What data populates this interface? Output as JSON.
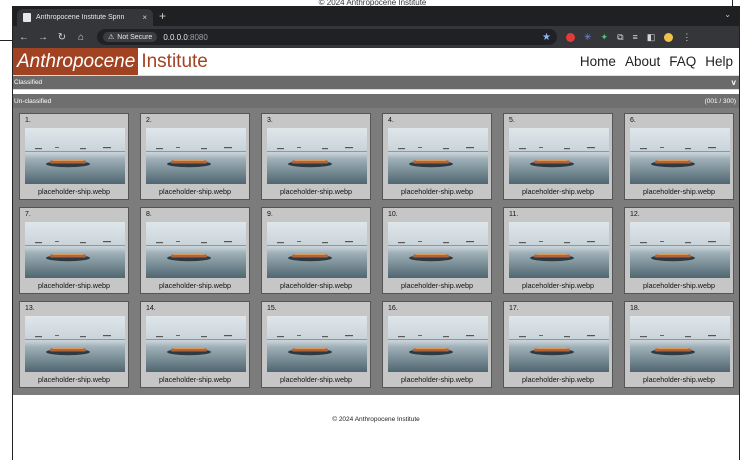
{
  "outer_caption": "© 2024 Anthropocene Institute",
  "browser": {
    "tab_title": "Anthropocene Institute Sprin",
    "tab_close": "×",
    "new_tab": "+",
    "menu_chevron": "⌄",
    "security_label": "Not Secure",
    "url_host": "0.0.0.0",
    "url_port": ":8080",
    "icons": [
      "back-icon",
      "forward-icon",
      "reload-icon",
      "home-icon",
      "bookmark-star-icon",
      "extension-icons",
      "side-panel-icon",
      "profile-icon",
      "kebab-menu-icon"
    ]
  },
  "site": {
    "logo_part1": "Anthropocene",
    "logo_part2": "Institute",
    "brand_color": "#a14322",
    "nav": [
      "Home",
      "About",
      "FAQ",
      "Help"
    ]
  },
  "sections": {
    "classified_label": "Classified",
    "classified_chevron": "v",
    "unclassified_label": "Un-classified",
    "unclassified_count": "(001 / 300)"
  },
  "cards": [
    {
      "num": "1.",
      "file": "placeholder-ship.webp"
    },
    {
      "num": "2.",
      "file": "placeholder-ship.webp"
    },
    {
      "num": "3.",
      "file": "placeholder-ship.webp"
    },
    {
      "num": "4.",
      "file": "placeholder-ship.webp"
    },
    {
      "num": "5.",
      "file": "placeholder-ship.webp"
    },
    {
      "num": "6.",
      "file": "placeholder-ship.webp"
    },
    {
      "num": "7.",
      "file": "placeholder-ship.webp"
    },
    {
      "num": "8.",
      "file": "placeholder-ship.webp"
    },
    {
      "num": "9.",
      "file": "placeholder-ship.webp"
    },
    {
      "num": "10.",
      "file": "placeholder-ship.webp"
    },
    {
      "num": "11.",
      "file": "placeholder-ship.webp"
    },
    {
      "num": "12.",
      "file": "placeholder-ship.webp"
    },
    {
      "num": "13.",
      "file": "placeholder-ship.webp"
    },
    {
      "num": "14.",
      "file": "placeholder-ship.webp"
    },
    {
      "num": "15.",
      "file": "placeholder-ship.webp"
    },
    {
      "num": "16.",
      "file": "placeholder-ship.webp"
    },
    {
      "num": "17.",
      "file": "placeholder-ship.webp"
    },
    {
      "num": "18.",
      "file": "placeholder-ship.webp"
    },
    {
      "num": "",
      "file": ""
    },
    {
      "num": "",
      "file": ""
    },
    {
      "num": "",
      "file": ""
    },
    {
      "num": "",
      "file": ""
    },
    {
      "num": "",
      "file": ""
    },
    {
      "num": "",
      "file": ""
    }
  ],
  "footer": {
    "copyright": "© 2024 Anthropocene Institute"
  }
}
